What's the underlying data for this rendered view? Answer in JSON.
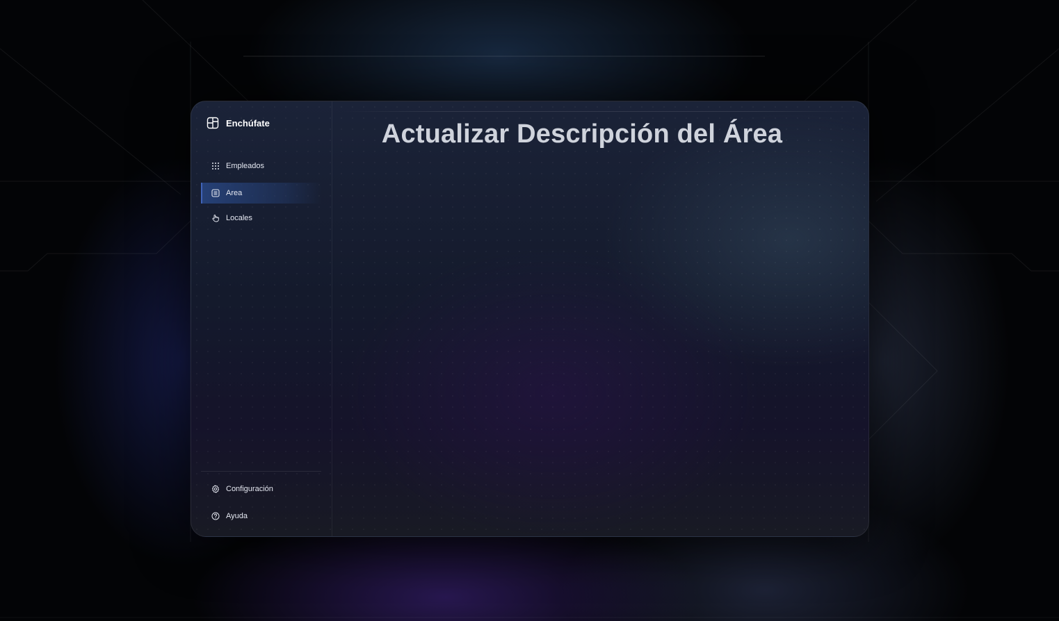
{
  "app": {
    "brand_name": "Enchúfate",
    "brand_icon": "layout-grid-icon"
  },
  "sidebar": {
    "items": [
      {
        "label": "Empleados",
        "icon": "dots-grid-icon",
        "active": false
      },
      {
        "label": "Area",
        "icon": "list-icon",
        "active": true
      },
      {
        "label": "Locales",
        "icon": "hand-pointer-icon",
        "active": false
      }
    ],
    "footer_items": [
      {
        "label": "Configuración",
        "icon": "gear-icon"
      },
      {
        "label": "Ayuda",
        "icon": "help-circle-icon"
      }
    ]
  },
  "main": {
    "title": "Actualizar Descripción del Área"
  },
  "colors": {
    "accent": "#3f63b8",
    "text": "#e6e9f2",
    "title": "#cfd3dc"
  }
}
